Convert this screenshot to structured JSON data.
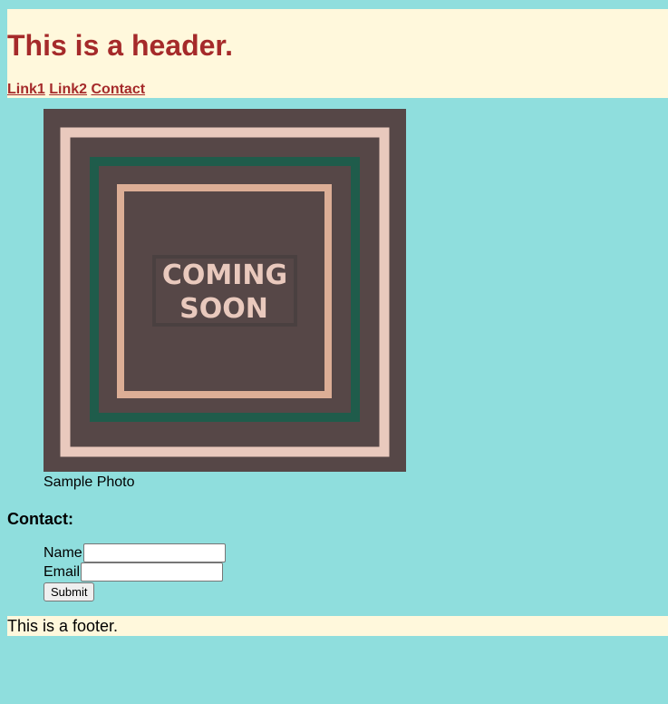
{
  "header": {
    "title": "This is a header.",
    "nav": [
      {
        "label": "Link1"
      },
      {
        "label": "Link2"
      },
      {
        "label": "Contact"
      }
    ]
  },
  "figure": {
    "image_text_line1": "COMING",
    "image_text_line2": "SOON",
    "caption": "Sample Photo"
  },
  "contact": {
    "heading": "Contact:",
    "name_label": "Name",
    "name_value": "",
    "email_label": "Email",
    "email_value": "",
    "submit_label": "Submit"
  },
  "footer": {
    "text": "This is a footer."
  },
  "colors": {
    "page_background": "#8fdedd",
    "header_footer_background": "#fff8dc",
    "accent_text": "#a52a2a",
    "image_background": "#564747",
    "image_frame_light": "#e9c9bd",
    "image_frame_green": "#1f5c4b",
    "image_frame_peach": "#dcae96"
  }
}
